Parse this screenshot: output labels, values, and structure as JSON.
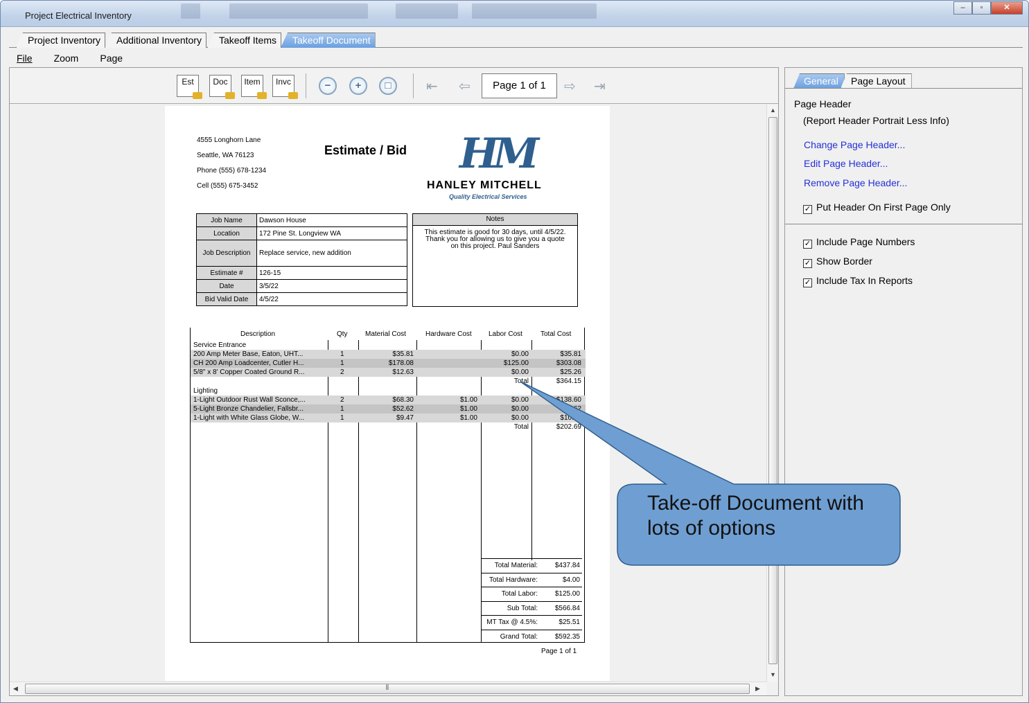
{
  "window": {
    "title": "Project Electrical Inventory"
  },
  "tabs": [
    "Project Inventory",
    "Additional Inventory",
    "Takeoff Items",
    "Takeoff Document"
  ],
  "menu": [
    "File",
    "Zoom",
    "Page"
  ],
  "toolbar": {
    "est": "Est",
    "doc": "Doc",
    "item": "Item",
    "invc": "Invc",
    "page_label": "Page 1 of 1"
  },
  "doc": {
    "address": [
      "4555 Longhorn Lane",
      "Seattle, WA 76123",
      "Phone (555) 678-1234",
      "Cell (555) 675-3452"
    ],
    "title": "Estimate / Bid",
    "logo_mark": "HM",
    "company": "HANLEY MITCHELL",
    "tagline": "Quality Electrical Services",
    "job": [
      {
        "k": "Job Name",
        "v": "Dawson House"
      },
      {
        "k": "Location",
        "v": "172 Pine St. Longview WA"
      },
      {
        "k": "Job Description",
        "v": "Replace service, new addition"
      },
      {
        "k": "Estimate #",
        "v": "126-15"
      },
      {
        "k": "Date",
        "v": "3/5/22"
      },
      {
        "k": "Bid Valid Date",
        "v": "4/5/22"
      }
    ],
    "notes_header": "Notes",
    "notes_text": "This estimate is good for 30 days, until 4/5/22. Thank you for allowing us to give you a quote on this project. Paul Sanders",
    "headers": [
      "Description",
      "Qty",
      "Material Cost",
      "Hardware Cost",
      "Labor Cost",
      "Total Cost"
    ],
    "section1": "Service Entrance",
    "rows1": [
      {
        "d": "200 Amp Meter Base, Eaton, UHT...",
        "q": "1",
        "m": "$35.81",
        "h": "",
        "l": "$0.00",
        "t": "$35.81"
      },
      {
        "d": "CH 200 Amp Loadcenter, Cutler H...",
        "q": "1",
        "m": "$178.08",
        "h": "",
        "l": "$125.00",
        "t": "$303.08"
      },
      {
        "d": "5/8\" x 8'  Copper Coated Ground R...",
        "q": "2",
        "m": "$12.63",
        "h": "",
        "l": "$0.00",
        "t": "$25.26"
      }
    ],
    "total1_label": "Total",
    "total1": "$364.15",
    "section2": "Lighting",
    "rows2": [
      {
        "d": "1-Light Outdoor Rust Wall Sconce,...",
        "q": "2",
        "m": "$68.30",
        "h": "$1.00",
        "l": "$0.00",
        "t": "$138.60"
      },
      {
        "d": "5-Light Bronze Chandelier, Fallsbr...",
        "q": "1",
        "m": "$52.62",
        "h": "$1.00",
        "l": "$0.00",
        "t": "$53.62"
      },
      {
        "d": "1-Light with White Glass Globe, W...",
        "q": "1",
        "m": "$9.47",
        "h": "$1.00",
        "l": "$0.00",
        "t": "$10.47"
      }
    ],
    "total2_label": "Total",
    "total2": "$202.69",
    "totals": [
      {
        "k": "Total Material:",
        "v": "$437.84"
      },
      {
        "k": "Total Hardware:",
        "v": "$4.00"
      },
      {
        "k": "Total Labor:",
        "v": "$125.00"
      },
      {
        "k": "Sub Total:",
        "v": "$566.84"
      },
      {
        "k": "MT Tax @ 4.5%:",
        "v": "$25.51"
      },
      {
        "k": "Grand Total:",
        "v": "$592.35"
      }
    ],
    "footer": "Page 1 of 1"
  },
  "right": {
    "tabs": [
      "General",
      "Page Layout"
    ],
    "page_header_label": "Page Header",
    "page_header_value": "(Report Header Portrait Less Info)",
    "links": [
      "Change Page Header...",
      "Edit Page Header...",
      "Remove Page Header..."
    ],
    "check_first_page": "Put Header On First Page Only",
    "checks": [
      "Include Page Numbers",
      "Show Border",
      "Include Tax In Reports"
    ]
  },
  "callout": [
    "Take-off Document with",
    "lots of options"
  ],
  "colors": {
    "tab_active": "#6a9fe0",
    "link": "#2430d6",
    "callout": "#6f9fd2"
  }
}
